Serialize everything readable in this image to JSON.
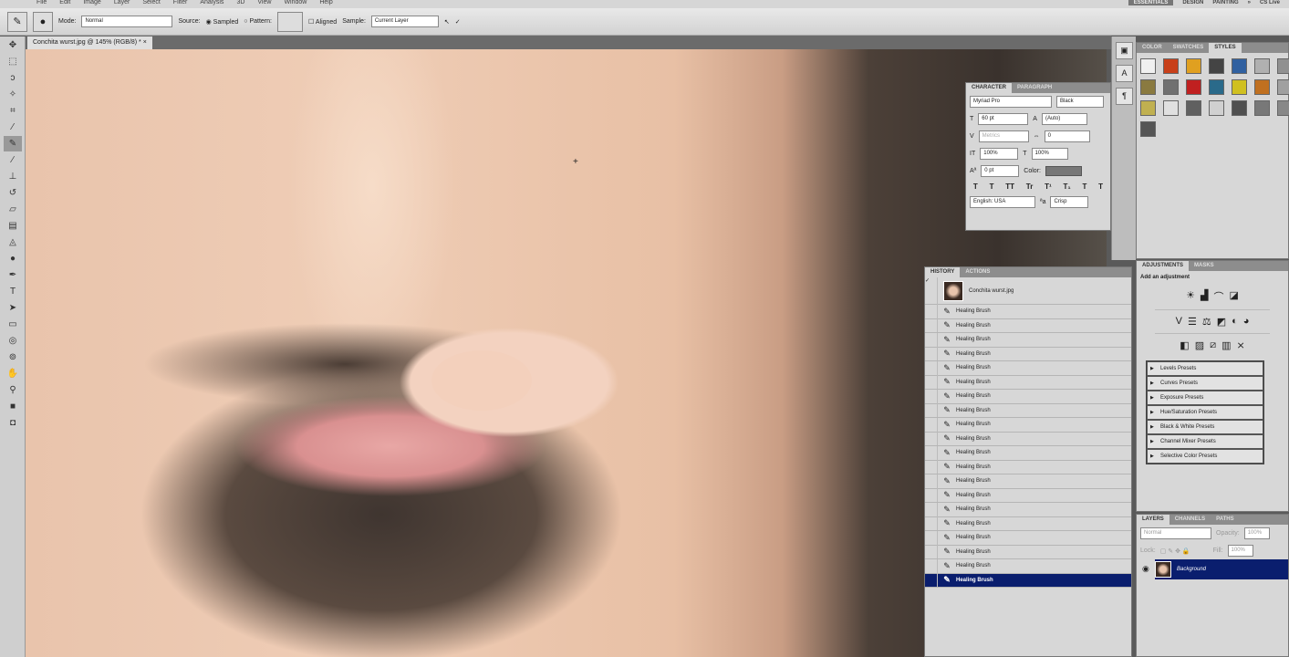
{
  "menu": [
    "File",
    "Edit",
    "Image",
    "Layer",
    "Select",
    "Filter",
    "Analysis",
    "3D",
    "View",
    "Window",
    "Help"
  ],
  "workspace": {
    "active": "ESSENTIALS",
    "items": [
      "DESIGN",
      "PAINTING",
      "»"
    ],
    "cs_live": "CS Live"
  },
  "options": {
    "mode_label": "Mode:",
    "mode_value": "Normal",
    "source_label": "Source:",
    "sampled": "Sampled",
    "pattern": "Pattern:",
    "aligned": "Aligned",
    "sample_label": "Sample:",
    "sample_value": "Current Layer"
  },
  "document": {
    "tab": "Conchita wurst.jpg @ 145% (RGB/8) *"
  },
  "styles": {
    "tabs": [
      "COLOR",
      "SWATCHES",
      "STYLES"
    ],
    "swatch_colors": [
      "#f0f0f0",
      "#c8401a",
      "#e0a020",
      "#444444",
      "#3060a0",
      "#b0b0b0",
      "#909090",
      "#8a7a40",
      "#707070",
      "#c02020",
      "#2a6a8a",
      "#d0c020",
      "#c07020",
      "#a0a0a0",
      "#c0b050",
      "#e0e0e0",
      "#606060",
      "#d0d0d0",
      "#505050",
      "#787878",
      "#888888",
      "#555555"
    ]
  },
  "character": {
    "tabs": [
      "CHARACTER",
      "PARAGRAPH"
    ],
    "font": "Myriad Pro",
    "style": "Black",
    "size": "60 pt",
    "leading": "(Auto)",
    "kerning": "Metrics",
    "tracking": "0",
    "vscale": "100%",
    "hscale": "100%",
    "baseline": "0 pt",
    "color_label": "Color:",
    "language": "English: USA",
    "aa": "Crisp",
    "type_buttons": [
      "T",
      "T",
      "TT",
      "Tr",
      "T¹",
      "T₁",
      "T",
      "T"
    ]
  },
  "history": {
    "tabs": [
      "HISTORY",
      "ACTIONS"
    ],
    "snapshot": "Conchita wurst.jpg",
    "items": [
      "Healing Brush",
      "Healing Brush",
      "Healing Brush",
      "Healing Brush",
      "Healing Brush",
      "Healing Brush",
      "Healing Brush",
      "Healing Brush",
      "Healing Brush",
      "Healing Brush",
      "Healing Brush",
      "Healing Brush",
      "Healing Brush",
      "Healing Brush",
      "Healing Brush",
      "Healing Brush",
      "Healing Brush",
      "Healing Brush",
      "Healing Brush",
      "Healing Brush"
    ]
  },
  "adjustments": {
    "tabs": [
      "ADJUSTMENTS",
      "MASKS"
    ],
    "title": "Add an adjustment",
    "presets": [
      "Levels Presets",
      "Curves Presets",
      "Exposure Presets",
      "Hue/Saturation Presets",
      "Black & White Presets",
      "Channel Mixer Presets",
      "Selective Color Presets"
    ]
  },
  "layers": {
    "tabs": [
      "LAYERS",
      "CHANNELS",
      "PATHS"
    ],
    "blend": "Normal",
    "opacity_label": "Opacity:",
    "opacity": "100%",
    "lock_label": "Lock:",
    "fill_label": "Fill:",
    "fill": "100%",
    "layer": "Background"
  }
}
